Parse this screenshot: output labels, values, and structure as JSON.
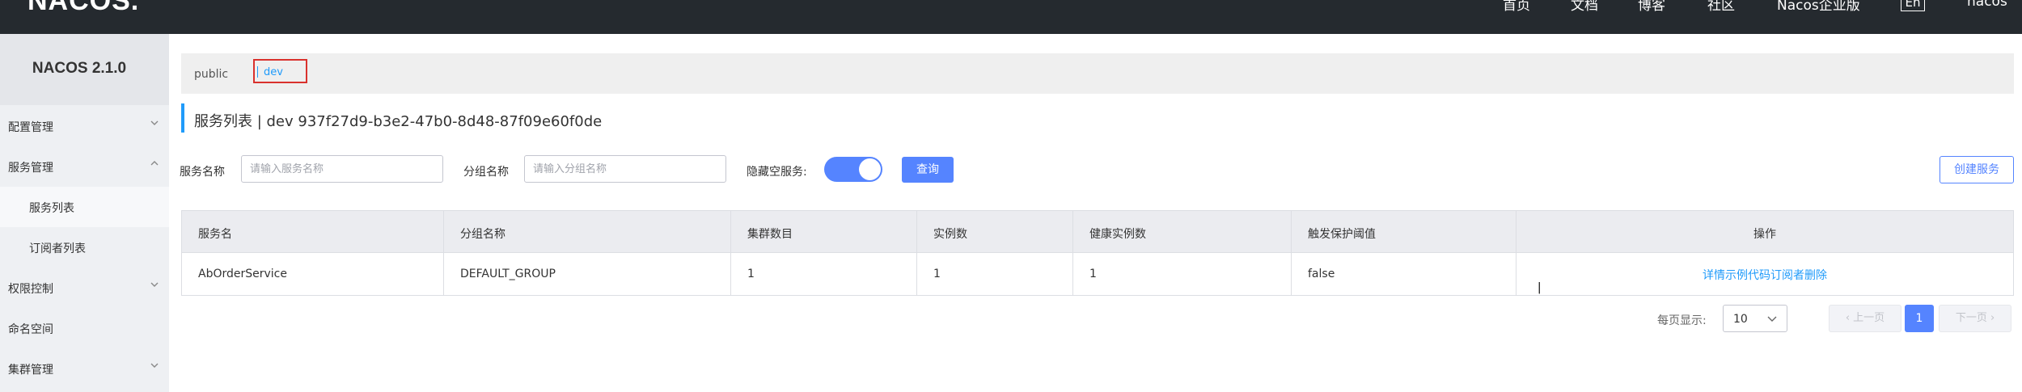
{
  "header": {
    "logo": "NACOS.",
    "nav": [
      "首页",
      "文档",
      "博客",
      "社区",
      "Nacos企业版"
    ],
    "lang": "En",
    "user": "nacos"
  },
  "sidebar": {
    "version": "NACOS 2.1.0",
    "items": [
      {
        "label": "配置管理",
        "expanded": false
      },
      {
        "label": "服务管理",
        "expanded": true
      },
      {
        "label": "服务列表",
        "sub": true,
        "active": true
      },
      {
        "label": "订阅者列表",
        "sub": true
      },
      {
        "label": "权限控制",
        "expanded": false
      },
      {
        "label": "命名空间"
      },
      {
        "label": "集群管理",
        "expanded": false
      }
    ]
  },
  "namespace": {
    "public": "public",
    "selected": "dev",
    "highlight_color": "#d9312d"
  },
  "page": {
    "title": "服务列表  |  dev  937f27d9-b3e2-47b0-8d48-87f09e60f0de"
  },
  "filters": {
    "service_name_label": "服务名称",
    "service_name_placeholder": "请输入服务名称",
    "group_name_label": "分组名称",
    "group_name_placeholder": "请输入分组名称",
    "hide_empty_label": "隐藏空服务:",
    "hide_empty_on": true,
    "query_button": "查询",
    "create_button": "创建服务"
  },
  "table": {
    "headers": [
      "服务名",
      "分组名称",
      "集群数目",
      "实例数",
      "健康实例数",
      "触发保护阈值",
      "操作"
    ],
    "rows": [
      {
        "service": "AbOrderService",
        "group": "DEFAULT_GROUP",
        "clusters": "1",
        "instances": "1",
        "healthy": "1",
        "threshold": "false",
        "actions": [
          "详情",
          "示例代码",
          "订阅者",
          "删除"
        ]
      }
    ]
  },
  "pagination": {
    "size_label": "每页显示:",
    "page_size": "10",
    "prev": "上一页",
    "current": "1",
    "next": "下一页"
  },
  "colors": {
    "accent": "#5584ff",
    "link": "#209bfa",
    "topbar": "#252a2f"
  }
}
